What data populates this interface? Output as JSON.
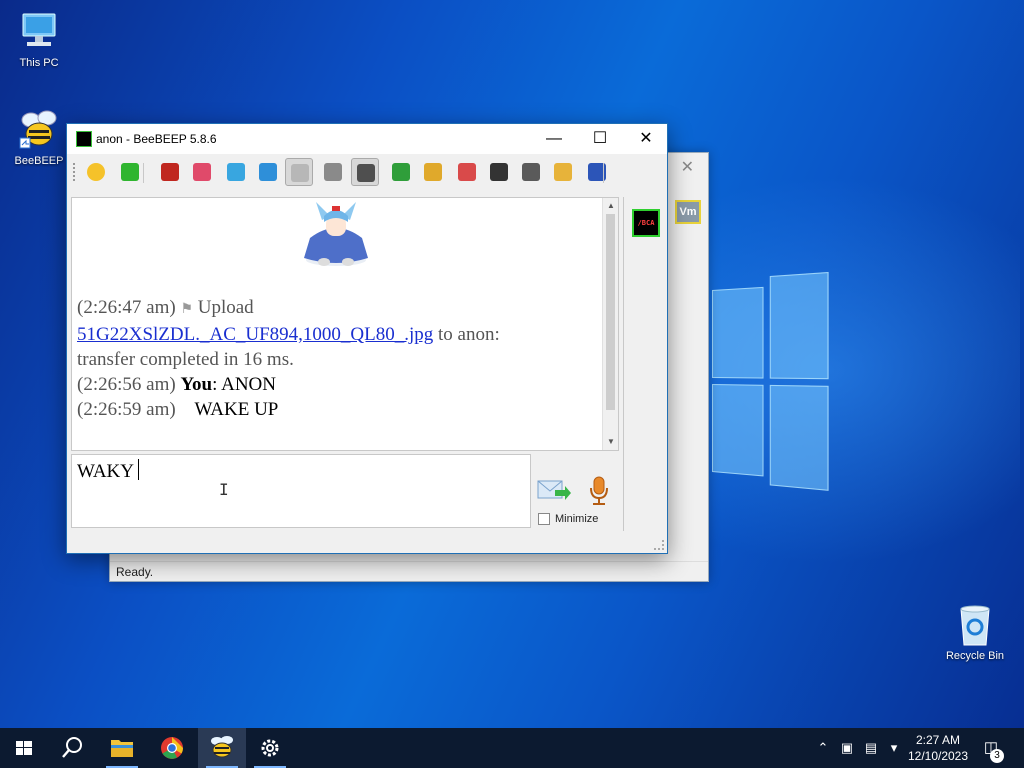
{
  "desktop": {
    "icons": [
      {
        "label": "This PC",
        "icon": "computer-icon"
      },
      {
        "label": "BeeBEEP",
        "icon": "bee-icon"
      },
      {
        "label": "Recycle Bin",
        "icon": "recycle-bin-icon"
      }
    ]
  },
  "bg_window": {
    "status": "Ready.",
    "badge": "Vm"
  },
  "window": {
    "title": "anon - BeeBEEP 5.8.6",
    "controls": {
      "minimize": "—",
      "maximize": "☐",
      "close": "✕"
    }
  },
  "toolbar": {
    "buttons": [
      {
        "icon": "emoticon-icon",
        "color": "#f5c22a"
      },
      {
        "icon": "green-down-arrow-icon",
        "color": "#2fb52f"
      },
      {
        "icon": "font-icon",
        "color": "#c0271f"
      },
      {
        "icon": "text-color-icon",
        "color": "#e04a6a"
      },
      {
        "icon": "filter-icon",
        "color": "#38a6e0"
      },
      {
        "icon": "settings-gear-icon",
        "color": "#2e8fd9"
      },
      {
        "icon": "spell-check-icon",
        "color": "#b7b7b7"
      },
      {
        "icon": "dictionary-icon",
        "color": "#8a8a8a"
      },
      {
        "icon": "music-note-icon",
        "color": "#4f4f4f"
      },
      {
        "icon": "send-file-icon",
        "color": "#2f9e3a"
      },
      {
        "icon": "send-folder-icon",
        "color": "#e0a92b"
      },
      {
        "icon": "html-code-icon",
        "color": "#d94a4a"
      },
      {
        "icon": "screenshot-camera-icon",
        "color": "#333333"
      },
      {
        "icon": "save-chat-icon",
        "color": "#5a5a5a"
      },
      {
        "icon": "notes-icon",
        "color": "#e7b33a"
      },
      {
        "icon": "save-floppy-icon",
        "color": "#2c55b8"
      }
    ]
  },
  "chat": {
    "upload": {
      "time": "(2:26:47 am)",
      "label": "Upload",
      "filename": "51G22XSlZDL._AC_UF894,1000_QL80_.jpg",
      "to": "to anon:",
      "result": "transfer completed in 16 ms."
    },
    "messages": [
      {
        "time": "(2:26:56 am)",
        "sender": "You",
        "sep": ": ",
        "text": "ANON"
      },
      {
        "time": "(2:26:59 am)",
        "sender": "",
        "sep": "",
        "text": "WAKE UP"
      }
    ]
  },
  "input": {
    "value": "WAKY",
    "minimize_label": "Minimize"
  },
  "side": {
    "avatar_text": "/BCA"
  },
  "taskbar": {
    "time": "2:27 AM",
    "date": "12/10/2023",
    "notification_count": "3"
  },
  "colors": {
    "accent": "#1f6fb5",
    "link": "#1a2fd0",
    "taskbar": "#0c1a30"
  }
}
